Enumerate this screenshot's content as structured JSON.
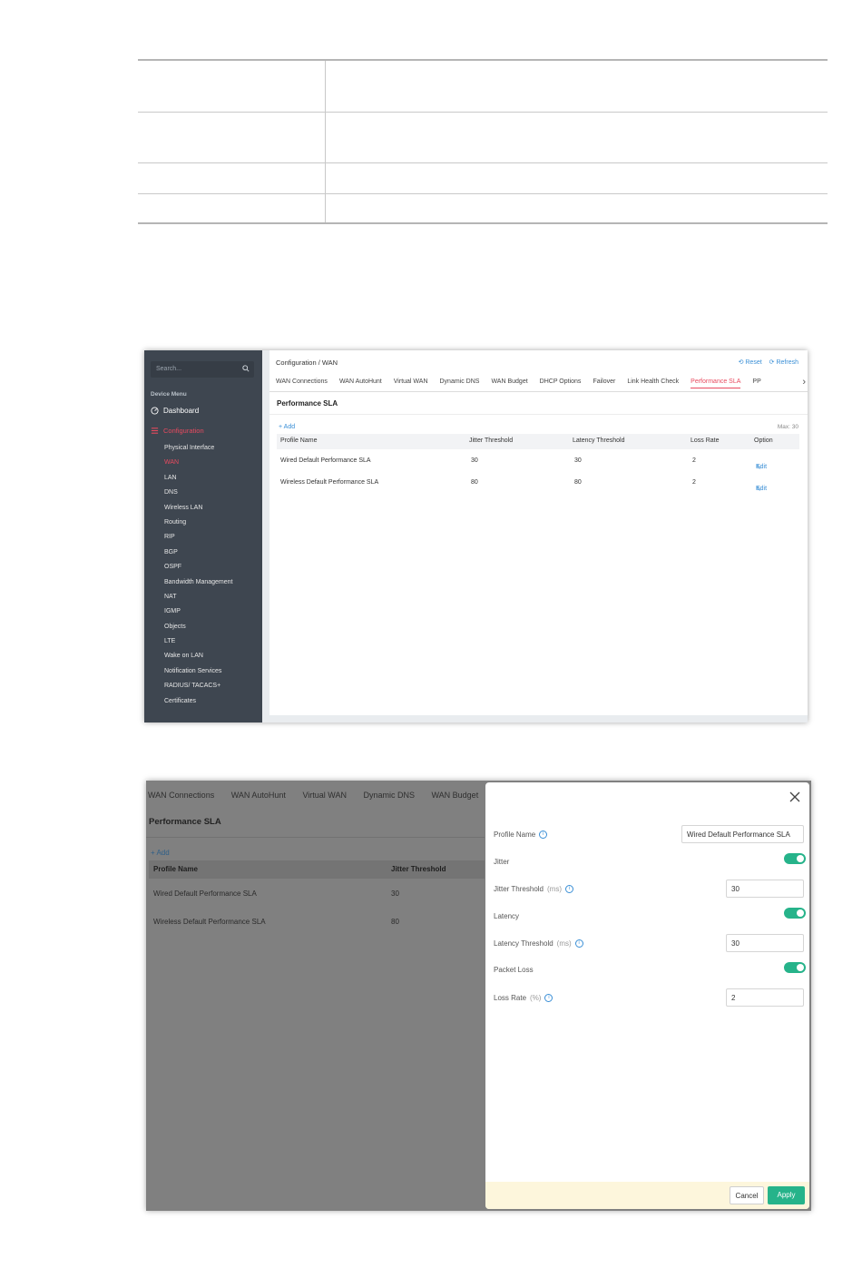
{
  "shot1": {
    "sidebar": {
      "search_placeholder": "Search...",
      "section_title": "Device Menu",
      "dashboard": "Dashboard",
      "configuration": "Configuration",
      "items": [
        "Physical Interface",
        "WAN",
        "LAN",
        "DNS",
        "Wireless LAN",
        "Routing",
        "RIP",
        "BGP",
        "OSPF",
        "Bandwidth Management",
        "NAT",
        "IGMP",
        "Objects",
        "LTE",
        "Wake on LAN",
        "Notification Services",
        "RADIUS/ TACACS+",
        "Certificates"
      ],
      "active_item": "WAN"
    },
    "breadcrumb": "Configuration / WAN",
    "reset": "Reset",
    "refresh": "Refresh",
    "tabs": [
      "WAN Connections",
      "WAN AutoHunt",
      "Virtual WAN",
      "Dynamic DNS",
      "WAN Budget",
      "DHCP Options",
      "Failover",
      "Link Health Check",
      "Performance SLA",
      "PP"
    ],
    "active_tab": "Performance SLA",
    "section_title": "Performance SLA",
    "add": "+ Add",
    "max": "Max: 30",
    "columns": [
      "Profile Name",
      "Jitter Threshold",
      "Latency Threshold",
      "Loss Rate",
      "Option"
    ],
    "rows": [
      {
        "name": "Wired Default Performance SLA",
        "jitter": "30",
        "latency": "30",
        "loss": "2",
        "option": "Edit"
      },
      {
        "name": "Wireless Default Performance SLA",
        "jitter": "80",
        "latency": "80",
        "loss": "2",
        "option": "Edit"
      }
    ]
  },
  "shot2": {
    "tabs": [
      "WAN Connections",
      "WAN AutoHunt",
      "Virtual WAN",
      "Dynamic DNS",
      "WAN Budget"
    ],
    "section_title": "Performance SLA",
    "add": "+ Add",
    "columns": [
      "Profile Name",
      "Jitter Threshold"
    ],
    "rows": [
      {
        "name": "Wired Default Performance SLA",
        "jitter": "30"
      },
      {
        "name": "Wireless Default Performance SLA",
        "jitter": "80"
      }
    ],
    "panel": {
      "profile_name_label": "Profile Name",
      "profile_name_value": "Wired Default Performance SLA",
      "jitter_label": "Jitter",
      "jitter_on": true,
      "jitter_threshold_label": "Jitter Threshold",
      "jitter_threshold_unit": "(ms)",
      "jitter_threshold_value": "30",
      "latency_label": "Latency",
      "latency_on": true,
      "latency_threshold_label": "Latency Threshold",
      "latency_threshold_unit": "(ms)",
      "latency_threshold_value": "30",
      "packet_loss_label": "Packet Loss",
      "packet_loss_on": true,
      "loss_rate_label": "Loss Rate",
      "loss_rate_unit": "(%)",
      "loss_rate_value": "2",
      "cancel": "Cancel",
      "apply": "Apply"
    }
  },
  "colors": {
    "accent_red": "#e84a5f",
    "link_blue": "#3a8fd6",
    "toggle_green": "#26b38a",
    "sidebar_bg": "#3e4650"
  }
}
